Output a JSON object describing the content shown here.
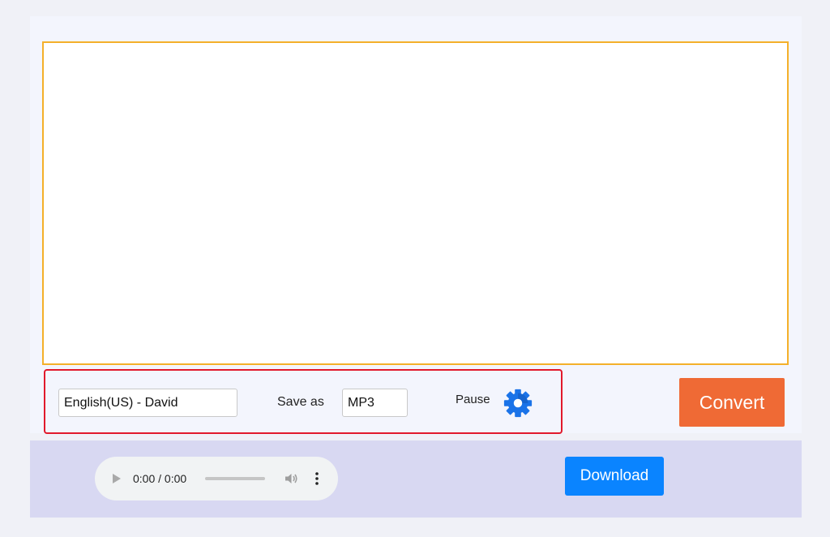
{
  "editor": {
    "text": "",
    "placeholder": ""
  },
  "options": {
    "voice_value": "English(US) - David",
    "save_as_label": "Save as",
    "format_value": "MP3",
    "pause_label": "Pause",
    "settings_icon": "gear-icon"
  },
  "actions": {
    "convert_label": "Convert",
    "download_label": "Download"
  },
  "player": {
    "time": "0:00 / 0:00",
    "progress": 0,
    "play_icon": "play-icon",
    "volume_icon": "volume-icon",
    "more_icon": "more-options-icon"
  },
  "colors": {
    "editor_border": "#f4b02a",
    "highlight_box": "#e1192b",
    "convert_bg": "#ef6a35",
    "download_bg": "#0a84ff",
    "gear": "#1a73e8",
    "bottom_panel_bg": "#d8d8f2"
  }
}
